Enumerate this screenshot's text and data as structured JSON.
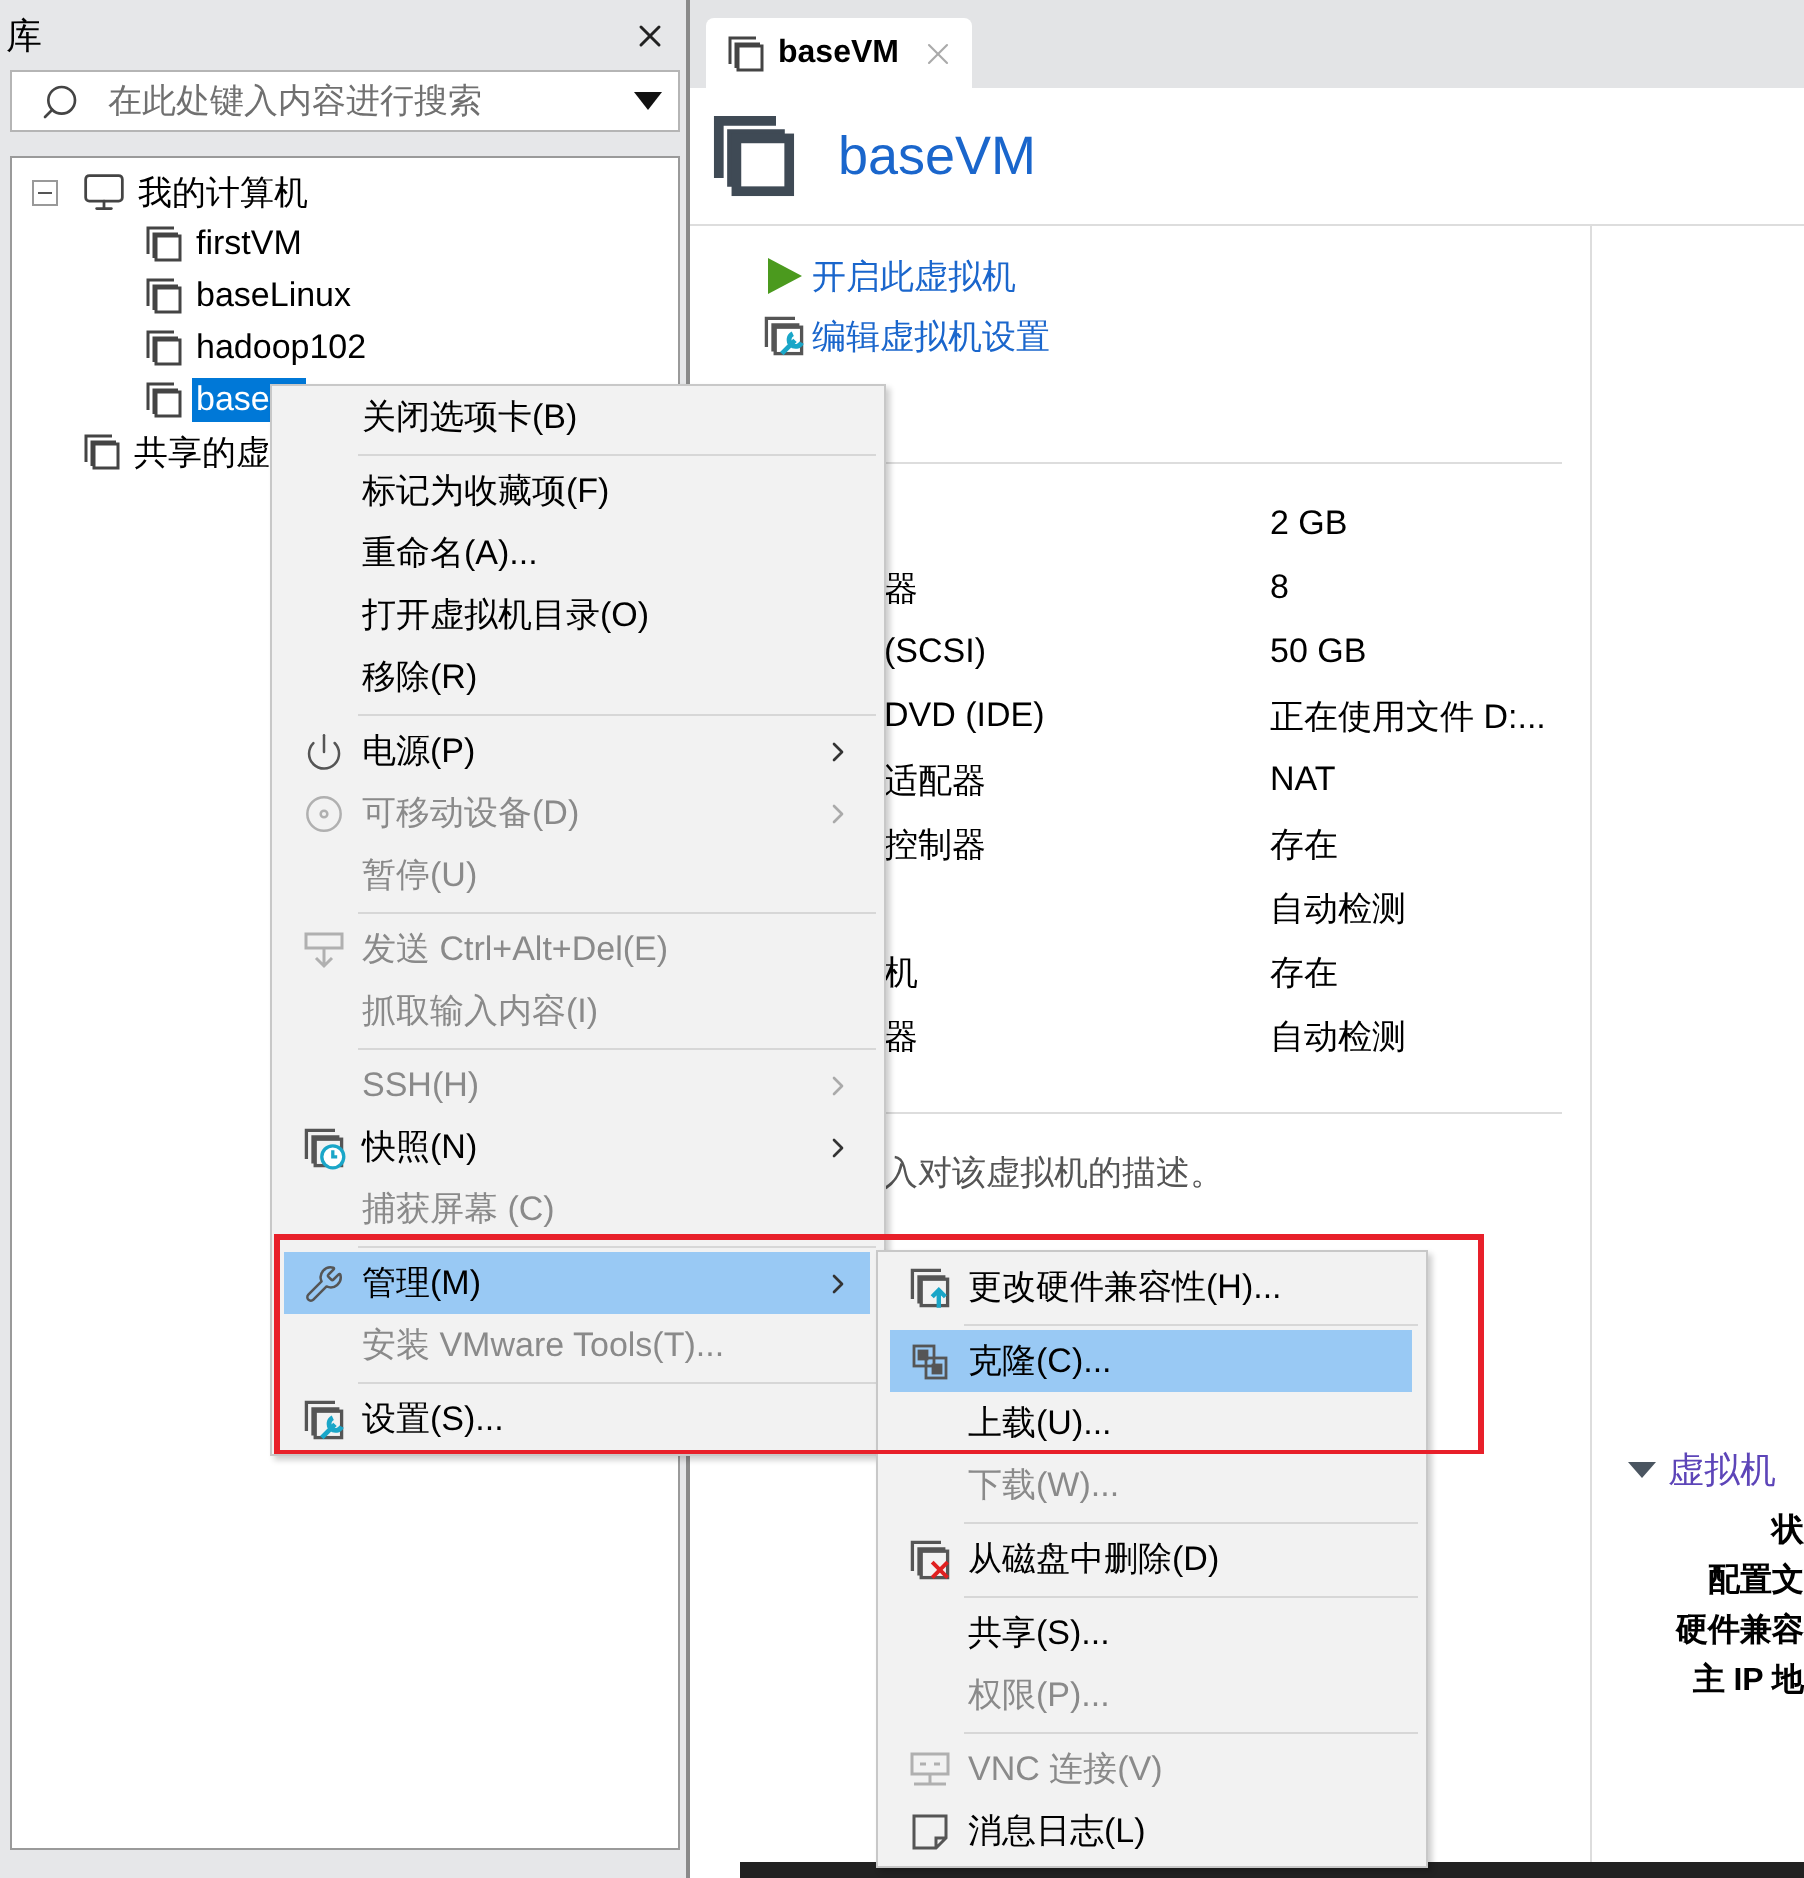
{
  "library": {
    "title": "库",
    "search": {
      "placeholder": "在此处键入内容进行搜索"
    },
    "tree": [
      {
        "label": "我的计算机",
        "kind": "computer",
        "expanded": true,
        "selected": false,
        "children": [
          {
            "label": "firstVM",
            "kind": "vm",
            "selected": false
          },
          {
            "label": "baseLinux",
            "kind": "vm",
            "selected": false
          },
          {
            "label": "hadoop102",
            "kind": "vm",
            "selected": false
          },
          {
            "label": "base",
            "kind": "vm",
            "selected": true
          }
        ]
      },
      {
        "label": "共享的虚",
        "kind": "shared",
        "selected": false
      }
    ]
  },
  "tabs": [
    {
      "label": "baseVM",
      "selected": true
    }
  ],
  "vm": {
    "name": "baseVM",
    "actions": [
      {
        "label": "开启此虚拟机",
        "kind": "play"
      },
      {
        "label": "编辑虚拟机设置",
        "kind": "settings"
      }
    ],
    "hardware": [
      {
        "value": "2 GB"
      },
      {
        "label": "器",
        "value": "8"
      },
      {
        "label": "(SCSI)",
        "value": "50 GB"
      },
      {
        "label": "DVD (IDE)",
        "value": "正在使用文件 D:..."
      },
      {
        "label": "适配器",
        "value": "NAT"
      },
      {
        "label": "控制器",
        "value": "存在"
      },
      {
        "value": "自动检测"
      },
      {
        "label": "机",
        "value": "存在"
      },
      {
        "label": "器",
        "value": "自动检测"
      }
    ],
    "description": "入对该虚拟机的描述。"
  },
  "details": {
    "title": "虚拟机",
    "expanded": true,
    "fields": [
      "状",
      "配置文",
      "硬件兼容",
      "主 IP 地"
    ]
  },
  "context_menu": {
    "items": [
      {
        "kind": "plain",
        "label": "关闭选项卡(B)",
        "disabled": false,
        "selected": false,
        "submenu": false
      },
      {
        "kind": "separator"
      },
      {
        "kind": "plain",
        "label": "标记为收藏项(F)",
        "disabled": false,
        "selected": false,
        "submenu": false
      },
      {
        "kind": "plain",
        "label": "重命名(A)...",
        "disabled": false,
        "selected": false,
        "submenu": false
      },
      {
        "kind": "plain",
        "label": "打开虚拟机目录(O)",
        "disabled": false,
        "selected": false,
        "submenu": false
      },
      {
        "kind": "plain",
        "label": "移除(R)",
        "disabled": false,
        "selected": false,
        "submenu": false
      },
      {
        "kind": "separator"
      },
      {
        "kind": "power",
        "label": "电源(P)",
        "disabled": false,
        "selected": false,
        "submenu": true
      },
      {
        "kind": "disc",
        "label": "可移动设备(D)",
        "disabled": true,
        "selected": false,
        "submenu": true
      },
      {
        "kind": "plain",
        "label": "暂停(U)",
        "disabled": true,
        "selected": false,
        "submenu": false
      },
      {
        "kind": "separator"
      },
      {
        "kind": "send",
        "label": "发送 Ctrl+Alt+Del(E)",
        "disabled": true,
        "selected": false,
        "submenu": false
      },
      {
        "kind": "plain",
        "label": "抓取输入内容(I)",
        "disabled": true,
        "selected": false,
        "submenu": false
      },
      {
        "kind": "separator"
      },
      {
        "kind": "plain",
        "label": "SSH(H)",
        "disabled": true,
        "selected": false,
        "submenu": true
      },
      {
        "kind": "snapshot",
        "label": "快照(N)",
        "disabled": false,
        "selected": false,
        "submenu": true
      },
      {
        "kind": "plain",
        "label": "捕获屏幕 (C)",
        "disabled": true,
        "selected": false,
        "submenu": false
      },
      {
        "kind": "separator"
      },
      {
        "kind": "wrench",
        "label": "管理(M)",
        "disabled": false,
        "selected": true,
        "submenu": true
      },
      {
        "kind": "plain",
        "label": "安装 VMware Tools(T)...",
        "disabled": true,
        "selected": false,
        "submenu": false
      },
      {
        "kind": "separator"
      },
      {
        "kind": "settings",
        "label": "设置(S)...",
        "disabled": false,
        "selected": false,
        "submenu": false
      }
    ]
  },
  "submenu": {
    "items": [
      {
        "kind": "upgrade",
        "label": "更改硬件兼容性(H)...",
        "disabled": false,
        "selected": false
      },
      {
        "kind": "separator"
      },
      {
        "kind": "clone",
        "label": "克隆(C)...",
        "disabled": false,
        "selected": true
      },
      {
        "kind": "plain",
        "label": "上载(U)...",
        "disabled": false,
        "selected": false
      },
      {
        "kind": "plain",
        "label": "下载(W)...",
        "disabled": true,
        "selected": false
      },
      {
        "kind": "separator"
      },
      {
        "kind": "delete",
        "label": "从磁盘中删除(D)",
        "disabled": false,
        "selected": false
      },
      {
        "kind": "separator"
      },
      {
        "kind": "plain",
        "label": "共享(S)...",
        "disabled": false,
        "selected": false
      },
      {
        "kind": "plain",
        "label": "权限(P)...",
        "disabled": true,
        "selected": false
      },
      {
        "kind": "separator"
      },
      {
        "kind": "vnc",
        "label": "VNC 连接(V)",
        "disabled": true,
        "selected": false
      },
      {
        "kind": "log",
        "label": "消息日志(L)",
        "disabled": false,
        "selected": false
      }
    ]
  }
}
